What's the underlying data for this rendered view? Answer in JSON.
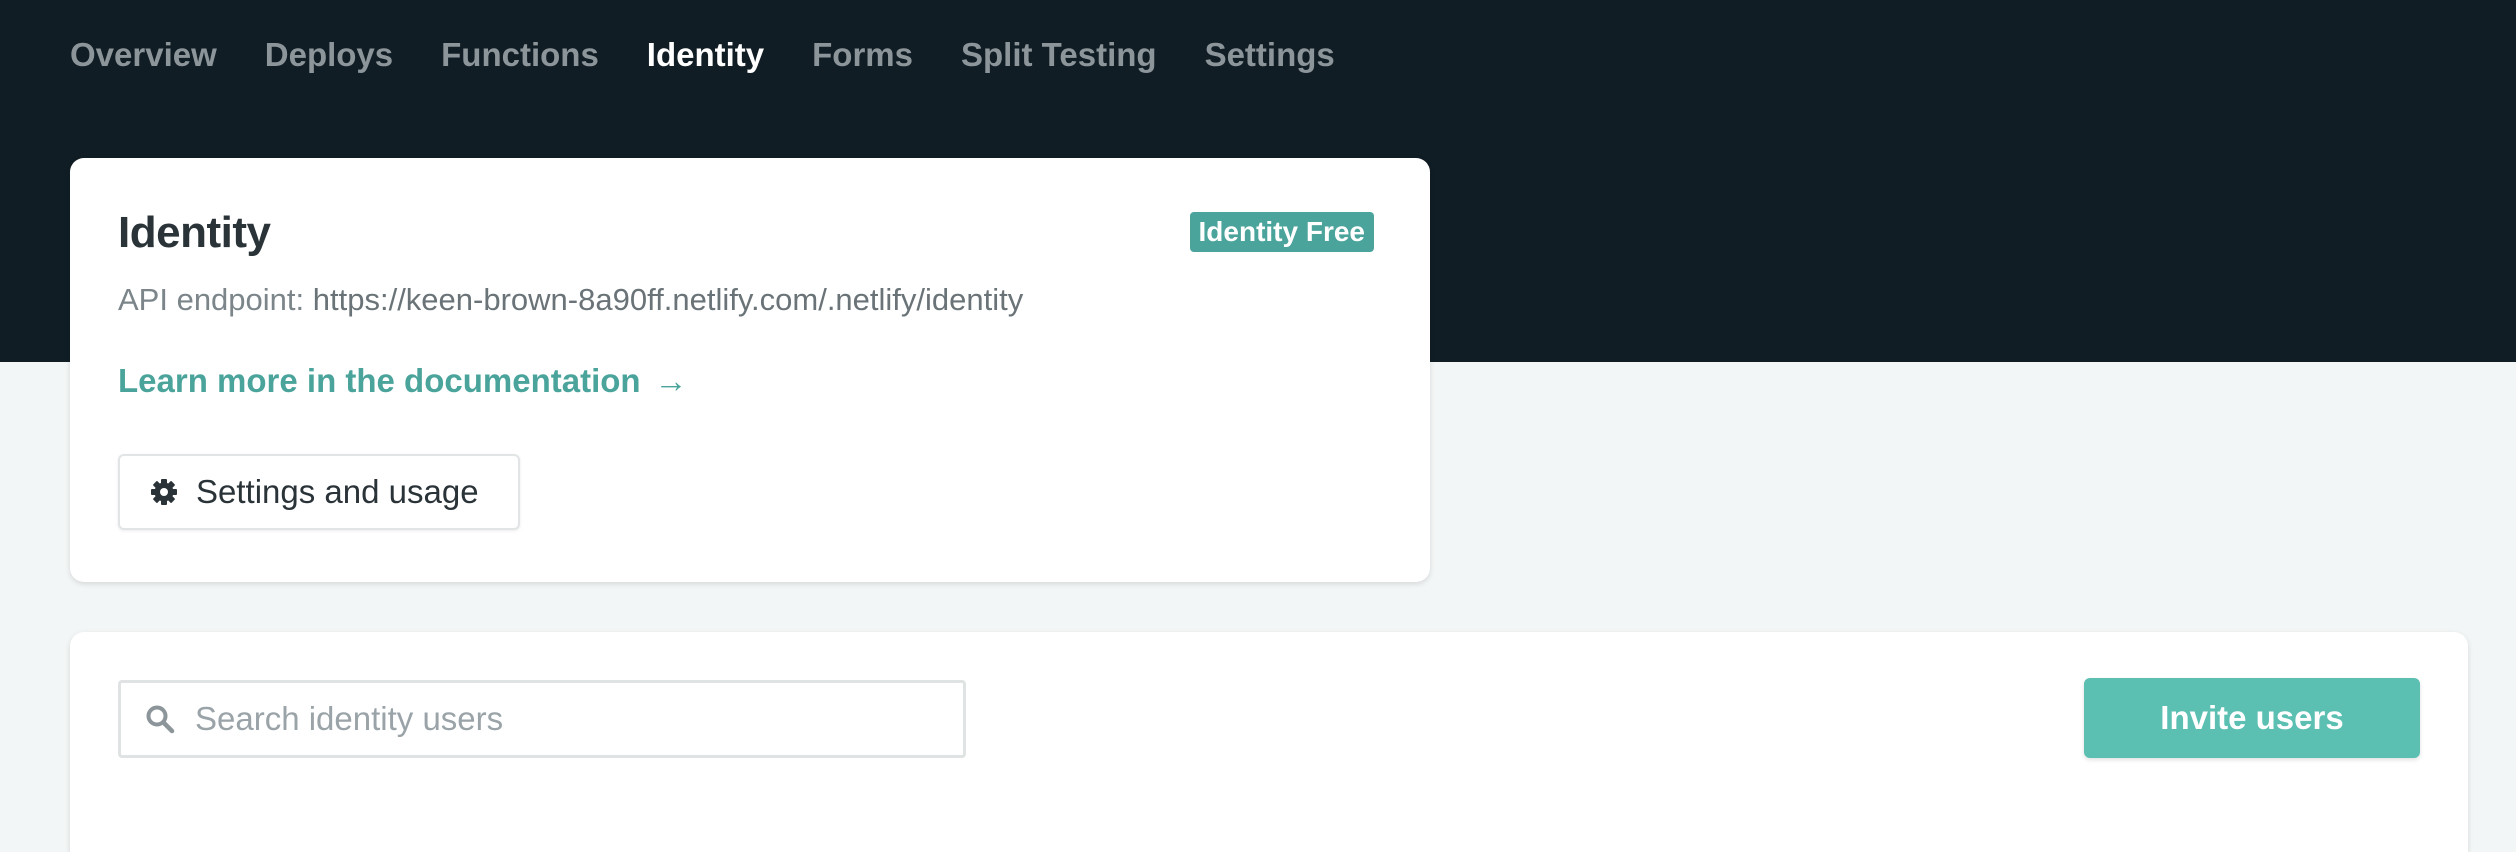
{
  "nav": {
    "items": [
      {
        "label": "Overview",
        "active": false
      },
      {
        "label": "Deploys",
        "active": false
      },
      {
        "label": "Functions",
        "active": false
      },
      {
        "label": "Identity",
        "active": true
      },
      {
        "label": "Forms",
        "active": false
      },
      {
        "label": "Split Testing",
        "active": false
      },
      {
        "label": "Settings",
        "active": false
      }
    ]
  },
  "identity_card": {
    "title": "Identity",
    "plan_badge": "Identity Free",
    "endpoint_label": "API endpoint:",
    "endpoint_url": "https://keen-brown-8a90ff.netlify.com/.netlify/identity",
    "doc_link": "Learn more in the documentation",
    "doc_link_arrow": "→",
    "settings_button": "Settings and usage",
    "settings_icon": "gear-icon"
  },
  "users": {
    "search_placeholder": "Search identity users",
    "search_value": "",
    "search_icon": "search-icon",
    "invite_button": "Invite users"
  },
  "colors": {
    "header_bg": "#111d25",
    "page_bg": "#f3f6f6",
    "accent": "#4aa49b",
    "invite_button": "#5bbfb2"
  }
}
